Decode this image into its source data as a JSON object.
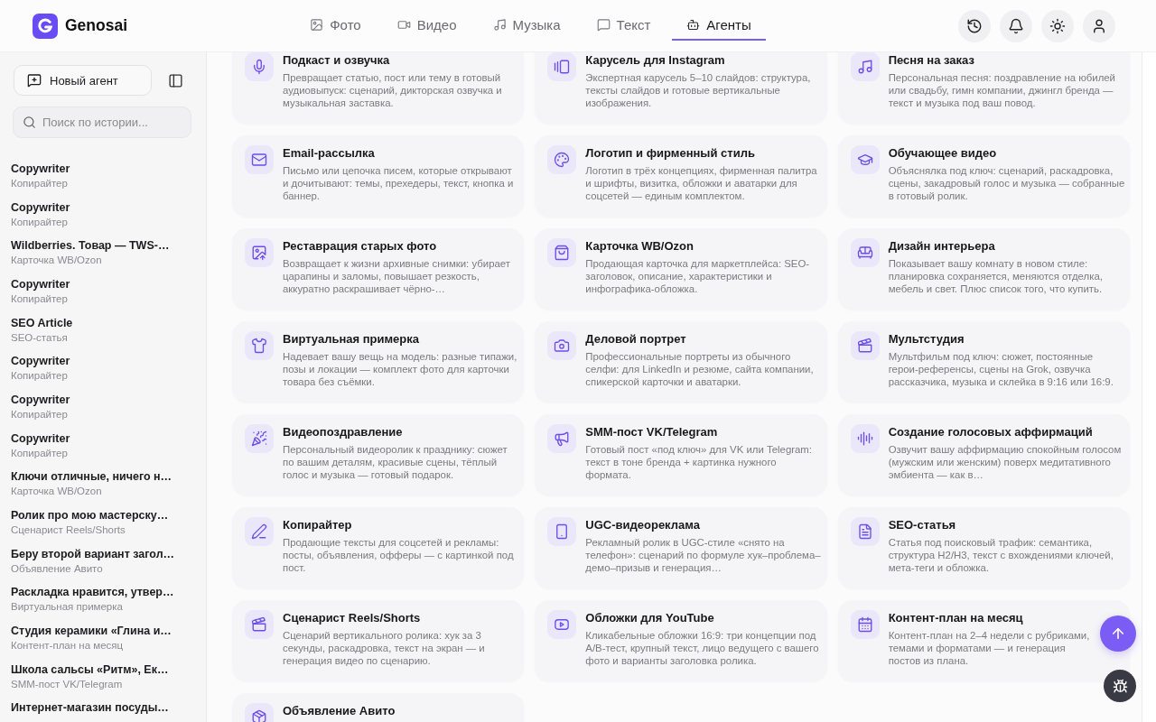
{
  "header": {
    "logo_text": "Genosai",
    "tabs": [
      {
        "label": "Фото",
        "selected": false
      },
      {
        "label": "Видео",
        "selected": false
      },
      {
        "label": "Музыка",
        "selected": false
      },
      {
        "label": "Текст",
        "selected": false
      },
      {
        "label": "Агенты",
        "selected": true
      }
    ]
  },
  "sidebar": {
    "new_agent_label": "Новый агент",
    "search": {
      "placeholder": "Поиск по истории..."
    },
    "history": [
      {
        "title": "Copywriter",
        "subtitle": "Копирайтер",
        "selected": false
      },
      {
        "title": "Copywriter",
        "subtitle": "Копирайтер",
        "selected": false
      },
      {
        "title": "Wildberries. Товар — TWS-…",
        "subtitle": "Карточка WB/Ozon",
        "selected": false
      },
      {
        "title": "Copywriter",
        "subtitle": "Копирайтер",
        "selected": false
      },
      {
        "title": "SEO Article",
        "subtitle": "SEO-статья",
        "selected": false
      },
      {
        "title": "Copywriter",
        "subtitle": "Копирайтер",
        "selected": false
      },
      {
        "title": "Copywriter",
        "subtitle": "Копирайтер",
        "selected": false
      },
      {
        "title": "Copywriter",
        "subtitle": "Копирайтер",
        "selected": false
      },
      {
        "title": "Ключи отличные, ничего н…",
        "subtitle": "Карточка WB/Ozon",
        "selected": false
      },
      {
        "title": "Ролик про мою мастерску…",
        "subtitle": "Сценарист Reels/Shorts",
        "selected": false
      },
      {
        "title": "Беру второй вариант загол…",
        "subtitle": "Объявление Авито",
        "selected": false
      },
      {
        "title": "Раскладка нравится, утвер…",
        "subtitle": "Виртуальная примерка",
        "selected": false
      },
      {
        "title": "Студия керамики «Глина и…",
        "subtitle": "Контент-план на месяц",
        "selected": false
      },
      {
        "title": "Школа сальсы «Ритм», Ек…",
        "subtitle": "SMM-пост VK/Telegram",
        "selected": false
      },
      {
        "title": "Интернет-магазин посуды…",
        "selected": false
      }
    ]
  },
  "agents": [
    {
      "title": "Подкаст и озвучка",
      "description": "Превращает статью, пост или тему в готовый аудиовыпуск: сценарий, дикторская озвучка и музыкальная заставка."
    },
    {
      "title": "Карусель для Instagram",
      "description": "Экспертная карусель 5–10 слайдов: структура, тексты слайдов и готовые вертикальные изображения."
    },
    {
      "title": "Песня на заказ",
      "description": "Персональная песня: поздравление на юбилей или свадьбу, гимн компании, джингл бренда — текст и музыка под ваш повод."
    },
    {
      "title": "Email-рассылка",
      "description": "Письмо или цепочка писем, которые открывают и дочитывают: темы, прехедеры, текст, кнопка и баннер."
    },
    {
      "title": "Логотип и фирменный стиль",
      "description": "Логотип в трёх концепциях, фирменная палитра и шрифты, визитка, обложки и аватарки для соцсетей — единым комплектом."
    },
    {
      "title": "Обучающее видео",
      "description": "Объяснялка под ключ: сценарий, раскадровка, сцены, закадровый голос и музыка — собранные в готовый ролик."
    },
    {
      "title": "Реставрация старых фото",
      "description": "Возвращает к жизни архивные снимки: убирает царапины и заломы, повышает резкость, аккуратно раскрашивает чёрно-…"
    },
    {
      "title": "Карточка WB/Ozon",
      "description": "Продающая карточка для маркетплейса: SEO-заголовок, описание, характеристики и инфографика-обложка."
    },
    {
      "title": "Дизайн интерьера",
      "description": "Показывает вашу комнату в новом стиле: планировка сохраняется, меняются отделка, мебель и свет. Плюс список того, что купить."
    },
    {
      "title": "Виртуальная примерка",
      "description": "Надевает вашу вещь на модель: разные типажи, позы и локации — комплект фото для карточки товара без съёмки."
    },
    {
      "title": "Деловой портрет",
      "description": "Профессиональные портреты из обычного селфи: для LinkedIn и резюме, сайта компании, спикерской карточки и аватарки."
    },
    {
      "title": "Мультстудия",
      "description": "Мультфильм под ключ: сюжет, постоянные герои-референсы, сцены на Grok, озвучка рассказчика, музыка и склейка в 9:16 или 16:9."
    },
    {
      "title": "Видеопоздравление",
      "description": "Персональный видеоролик к празднику: сюжет по вашим деталям, красивые сцены, тёплый голос и музыка — готовый подарок."
    },
    {
      "title": "SMM-пост VK/Telegram",
      "description": "Готовый пост «под ключ» для VK или Telegram: текст в тоне бренда + картинка нужного формата."
    },
    {
      "title": "Создание голосовых аффирмаций",
      "description": "Озвучит вашу аффирмацию спокойным голосом (мужским или женским) поверх медитативного эмбиента — как в…"
    },
    {
      "title": "Копирайтер",
      "description": "Продающие тексты для соцсетей и рекламы: посты, объявления, офферы — с картинкой под пост."
    },
    {
      "title": "UGC-видеореклама",
      "description": "Рекламный ролик в UGC-стиле «снято на телефон»: сценарий по формуле хук–проблема–демо–призыв и генерация…"
    },
    {
      "title": "SEO-статья",
      "description": "Статья под поисковый трафик: семантика, структура H2/H3, текст с вхождениями ключей, мета-теги и обложка."
    },
    {
      "title": "Сценарист Reels/Shorts",
      "description": "Сценарий вертикального ролика: хук за 3 секунды, раскадровка, текст на экран — и генерация видео по сценарию."
    },
    {
      "title": "Обложки для YouTube",
      "description": "Кликабельные обложки 16:9: три концепции под A/B-тест, крупный текст, лицо ведущего с вашего фото и варианты заголовка ролика."
    },
    {
      "title": "Контент-план на месяц",
      "description": "Контент-план на 2–4 недели с рубриками, темами и форматами — и генерация постов из плана."
    },
    {
      "title": "Объявление Авито"
    }
  ]
}
